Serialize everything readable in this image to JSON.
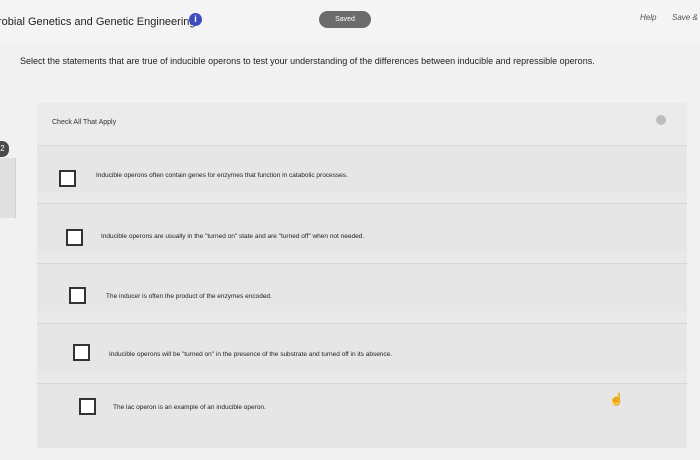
{
  "header": {
    "course_title": "robial Genetics and Genetic Engineering",
    "info_glyph": "i",
    "saved_label": "Saved",
    "help_label": "Help",
    "save_label": "Save &"
  },
  "rail": {
    "badge": "2"
  },
  "instructions": "Select the statements that are true of inducible operons to test your understanding of the differences between inducible and repressible operons.",
  "panel": {
    "heading": "Check All That Apply",
    "options": [
      {
        "text": "Inducible operons often contain genes for enzymes that function in catabolic processes."
      },
      {
        "text": "Inducible operons are usually in the \"turned on\" state and are \"turned off\" when not needed."
      },
      {
        "text": "The inducer is often the product of the enzymes encoded."
      },
      {
        "text": "Inducible operons will be \"turned on\" in the presence of the substrate and turned off in its absence."
      },
      {
        "text": "The lac operon is an example of an inducible operon."
      }
    ]
  },
  "icons": {
    "cursor": "hand-pointer-icon",
    "info": "info-icon"
  }
}
